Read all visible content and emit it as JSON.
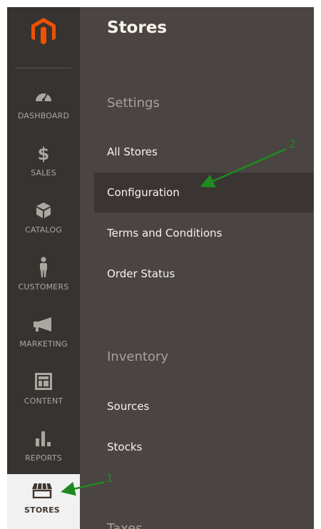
{
  "colors": {
    "sidebar_bg": "#373330",
    "panel_bg": "#4a4542",
    "brand_orange": "#eb5202",
    "active_bg": "#f1f1f1",
    "annotation_green": "#1f8a1f"
  },
  "logo": {
    "icon": "magento-logo-icon"
  },
  "sidebar": {
    "items": [
      {
        "icon": "dashboard-gauge-icon",
        "label": "DASHBOARD"
      },
      {
        "icon": "dollar-icon",
        "label": "SALES"
      },
      {
        "icon": "box-icon",
        "label": "CATALOG"
      },
      {
        "icon": "person-icon",
        "label": "CUSTOMERS"
      },
      {
        "icon": "megaphone-icon",
        "label": "MARKETING"
      },
      {
        "icon": "layout-icon",
        "label": "CONTENT"
      },
      {
        "icon": "bar-chart-icon",
        "label": "REPORTS"
      },
      {
        "icon": "storefront-icon",
        "label": "STORES",
        "active": true
      }
    ]
  },
  "panel": {
    "title": "Stores",
    "sections": [
      {
        "title": "Settings",
        "links": [
          "All Stores",
          "Configuration",
          "Terms and Conditions",
          "Order Status"
        ],
        "highlighted": "Configuration"
      },
      {
        "title": "Inventory",
        "links": [
          "Sources",
          "Stocks"
        ]
      },
      {
        "title": "Taxes",
        "links": []
      }
    ]
  },
  "annotations": [
    {
      "number": "1"
    },
    {
      "number": "2"
    }
  ]
}
